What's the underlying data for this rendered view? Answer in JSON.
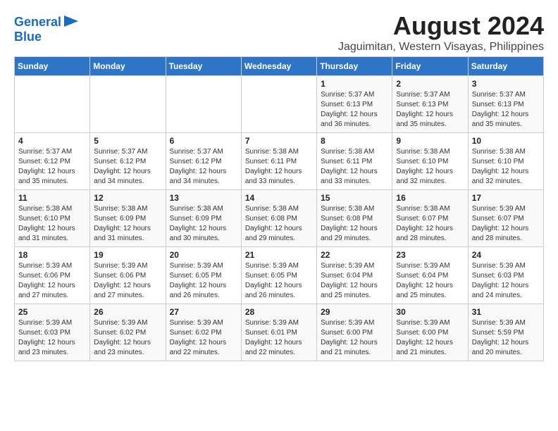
{
  "header": {
    "logo_line1": "General",
    "logo_line2": "Blue",
    "title": "August 2024",
    "subtitle": "Jaguimitan, Western Visayas, Philippines"
  },
  "calendar": {
    "columns": [
      "Sunday",
      "Monday",
      "Tuesday",
      "Wednesday",
      "Thursday",
      "Friday",
      "Saturday"
    ],
    "weeks": [
      [
        {
          "day": "",
          "info": ""
        },
        {
          "day": "",
          "info": ""
        },
        {
          "day": "",
          "info": ""
        },
        {
          "day": "",
          "info": ""
        },
        {
          "day": "1",
          "info": "Sunrise: 5:37 AM\nSunset: 6:13 PM\nDaylight: 12 hours\nand 36 minutes."
        },
        {
          "day": "2",
          "info": "Sunrise: 5:37 AM\nSunset: 6:13 PM\nDaylight: 12 hours\nand 35 minutes."
        },
        {
          "day": "3",
          "info": "Sunrise: 5:37 AM\nSunset: 6:13 PM\nDaylight: 12 hours\nand 35 minutes."
        }
      ],
      [
        {
          "day": "4",
          "info": "Sunrise: 5:37 AM\nSunset: 6:12 PM\nDaylight: 12 hours\nand 35 minutes."
        },
        {
          "day": "5",
          "info": "Sunrise: 5:37 AM\nSunset: 6:12 PM\nDaylight: 12 hours\nand 34 minutes."
        },
        {
          "day": "6",
          "info": "Sunrise: 5:37 AM\nSunset: 6:12 PM\nDaylight: 12 hours\nand 34 minutes."
        },
        {
          "day": "7",
          "info": "Sunrise: 5:38 AM\nSunset: 6:11 PM\nDaylight: 12 hours\nand 33 minutes."
        },
        {
          "day": "8",
          "info": "Sunrise: 5:38 AM\nSunset: 6:11 PM\nDaylight: 12 hours\nand 33 minutes."
        },
        {
          "day": "9",
          "info": "Sunrise: 5:38 AM\nSunset: 6:10 PM\nDaylight: 12 hours\nand 32 minutes."
        },
        {
          "day": "10",
          "info": "Sunrise: 5:38 AM\nSunset: 6:10 PM\nDaylight: 12 hours\nand 32 minutes."
        }
      ],
      [
        {
          "day": "11",
          "info": "Sunrise: 5:38 AM\nSunset: 6:10 PM\nDaylight: 12 hours\nand 31 minutes."
        },
        {
          "day": "12",
          "info": "Sunrise: 5:38 AM\nSunset: 6:09 PM\nDaylight: 12 hours\nand 31 minutes."
        },
        {
          "day": "13",
          "info": "Sunrise: 5:38 AM\nSunset: 6:09 PM\nDaylight: 12 hours\nand 30 minutes."
        },
        {
          "day": "14",
          "info": "Sunrise: 5:38 AM\nSunset: 6:08 PM\nDaylight: 12 hours\nand 29 minutes."
        },
        {
          "day": "15",
          "info": "Sunrise: 5:38 AM\nSunset: 6:08 PM\nDaylight: 12 hours\nand 29 minutes."
        },
        {
          "day": "16",
          "info": "Sunrise: 5:38 AM\nSunset: 6:07 PM\nDaylight: 12 hours\nand 28 minutes."
        },
        {
          "day": "17",
          "info": "Sunrise: 5:39 AM\nSunset: 6:07 PM\nDaylight: 12 hours\nand 28 minutes."
        }
      ],
      [
        {
          "day": "18",
          "info": "Sunrise: 5:39 AM\nSunset: 6:06 PM\nDaylight: 12 hours\nand 27 minutes."
        },
        {
          "day": "19",
          "info": "Sunrise: 5:39 AM\nSunset: 6:06 PM\nDaylight: 12 hours\nand 27 minutes."
        },
        {
          "day": "20",
          "info": "Sunrise: 5:39 AM\nSunset: 6:05 PM\nDaylight: 12 hours\nand 26 minutes."
        },
        {
          "day": "21",
          "info": "Sunrise: 5:39 AM\nSunset: 6:05 PM\nDaylight: 12 hours\nand 26 minutes."
        },
        {
          "day": "22",
          "info": "Sunrise: 5:39 AM\nSunset: 6:04 PM\nDaylight: 12 hours\nand 25 minutes."
        },
        {
          "day": "23",
          "info": "Sunrise: 5:39 AM\nSunset: 6:04 PM\nDaylight: 12 hours\nand 25 minutes."
        },
        {
          "day": "24",
          "info": "Sunrise: 5:39 AM\nSunset: 6:03 PM\nDaylight: 12 hours\nand 24 minutes."
        }
      ],
      [
        {
          "day": "25",
          "info": "Sunrise: 5:39 AM\nSunset: 6:03 PM\nDaylight: 12 hours\nand 23 minutes."
        },
        {
          "day": "26",
          "info": "Sunrise: 5:39 AM\nSunset: 6:02 PM\nDaylight: 12 hours\nand 23 minutes."
        },
        {
          "day": "27",
          "info": "Sunrise: 5:39 AM\nSunset: 6:02 PM\nDaylight: 12 hours\nand 22 minutes."
        },
        {
          "day": "28",
          "info": "Sunrise: 5:39 AM\nSunset: 6:01 PM\nDaylight: 12 hours\nand 22 minutes."
        },
        {
          "day": "29",
          "info": "Sunrise: 5:39 AM\nSunset: 6:00 PM\nDaylight: 12 hours\nand 21 minutes."
        },
        {
          "day": "30",
          "info": "Sunrise: 5:39 AM\nSunset: 6:00 PM\nDaylight: 12 hours\nand 21 minutes."
        },
        {
          "day": "31",
          "info": "Sunrise: 5:39 AM\nSunset: 5:59 PM\nDaylight: 12 hours\nand 20 minutes."
        }
      ]
    ]
  }
}
